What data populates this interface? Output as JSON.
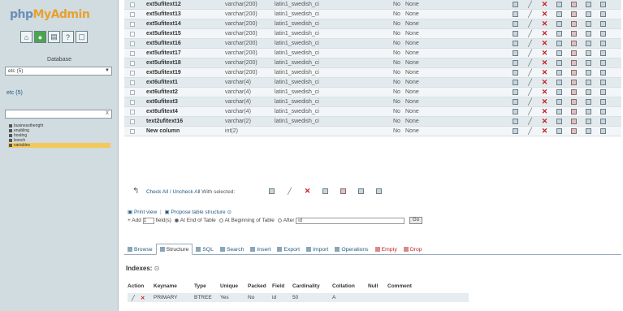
{
  "nav": {
    "logo_part1": "php",
    "logo_part2": "MyAdmin",
    "icons": [
      "home-icon",
      "exit-icon",
      "sql-icon",
      "docs-icon",
      "docs2-icon"
    ],
    "database_label": "Database",
    "database_select": "etc (5)",
    "database_link": "etc (5)",
    "filter_clear": "X",
    "tables": [
      {
        "name": "businesstheright",
        "active": false
      },
      {
        "name": "enabling",
        "active": false
      },
      {
        "name": "hosting",
        "active": false
      },
      {
        "name": "lessch",
        "active": false
      },
      {
        "name": "variables",
        "active": true
      }
    ]
  },
  "fields": [
    {
      "name": "ext5ufitext12",
      "type": "varchar(200)",
      "collation": "latin1_swedish_ci",
      "null": "No",
      "default": "None"
    },
    {
      "name": "ext5ufitext13",
      "type": "varchar(200)",
      "collation": "latin1_swedish_ci",
      "null": "No",
      "default": "None"
    },
    {
      "name": "ext5ufitext14",
      "type": "varchar(200)",
      "collation": "latin1_swedish_ci",
      "null": "No",
      "default": "None"
    },
    {
      "name": "ext5ufitext15",
      "type": "varchar(200)",
      "collation": "latin1_swedish_ci",
      "null": "No",
      "default": "None"
    },
    {
      "name": "ext5ufitext16",
      "type": "varchar(200)",
      "collation": "latin1_swedish_ci",
      "null": "No",
      "default": "None"
    },
    {
      "name": "ext5ufitext17",
      "type": "varchar(200)",
      "collation": "latin1_swedish_ci",
      "null": "No",
      "default": "None"
    },
    {
      "name": "ext5ufitext18",
      "type": "varchar(200)",
      "collation": "latin1_swedish_ci",
      "null": "No",
      "default": "None"
    },
    {
      "name": "ext5ufitext19",
      "type": "varchar(200)",
      "collation": "latin1_swedish_ci",
      "null": "No",
      "default": "None"
    },
    {
      "name": "ext6ufitext1",
      "type": "varchar(4)",
      "collation": "latin1_swedish_ci",
      "null": "No",
      "default": "None"
    },
    {
      "name": "ext6ufitext2",
      "type": "varchar(4)",
      "collation": "latin1_swedish_ci",
      "null": "No",
      "default": "None"
    },
    {
      "name": "ext6ufitext3",
      "type": "varchar(4)",
      "collation": "latin1_swedish_ci",
      "null": "No",
      "default": "None"
    },
    {
      "name": "ext6ufitext4",
      "type": "varchar(4)",
      "collation": "latin1_swedish_ci",
      "null": "No",
      "default": "None"
    },
    {
      "name": "text2ufitext16",
      "type": "varchar(2)",
      "collation": "latin1_swedish_ci",
      "null": "No",
      "default": "None"
    },
    {
      "name": "New column",
      "type": "int(2)",
      "collation": "",
      "null": "No",
      "default": "None"
    }
  ],
  "check_all": {
    "label": "Check All / Uncheck All",
    "with_selected": "With selected:"
  },
  "print_row": {
    "print_view": "Print view",
    "propose": "Propose table structure"
  },
  "add_row": {
    "add": "Add",
    "count": "1",
    "fields_label": "field(s)",
    "at_end": "At End of Table",
    "at_beginning": "At Beginning of Table",
    "after": "After",
    "after_value": "id",
    "go": "Go"
  },
  "tabs": [
    {
      "label": "Browse",
      "active": false,
      "danger": false
    },
    {
      "label": "Structure",
      "active": true,
      "danger": false
    },
    {
      "label": "SQL",
      "active": false,
      "danger": false
    },
    {
      "label": "Search",
      "active": false,
      "danger": false
    },
    {
      "label": "Insert",
      "active": false,
      "danger": false
    },
    {
      "label": "Export",
      "active": false,
      "danger": false
    },
    {
      "label": "Import",
      "active": false,
      "danger": false
    },
    {
      "label": "Operations",
      "active": false,
      "danger": false
    },
    {
      "label": "Empty",
      "active": false,
      "danger": true
    },
    {
      "label": "Drop",
      "active": false,
      "danger": true
    }
  ],
  "indexes": {
    "title": "Indexes:",
    "help": "⊙",
    "headers": [
      "Action",
      "Keyname",
      "Type",
      "Unique",
      "Packed",
      "Field",
      "Cardinality",
      "Collation",
      "Null",
      "Comment"
    ],
    "row": {
      "keyname": "PRIMARY",
      "type": "BTREE",
      "unique": "Yes",
      "packed": "No",
      "field": "id",
      "cardinality": "50",
      "collation": "A",
      "null": "",
      "comment": ""
    }
  }
}
